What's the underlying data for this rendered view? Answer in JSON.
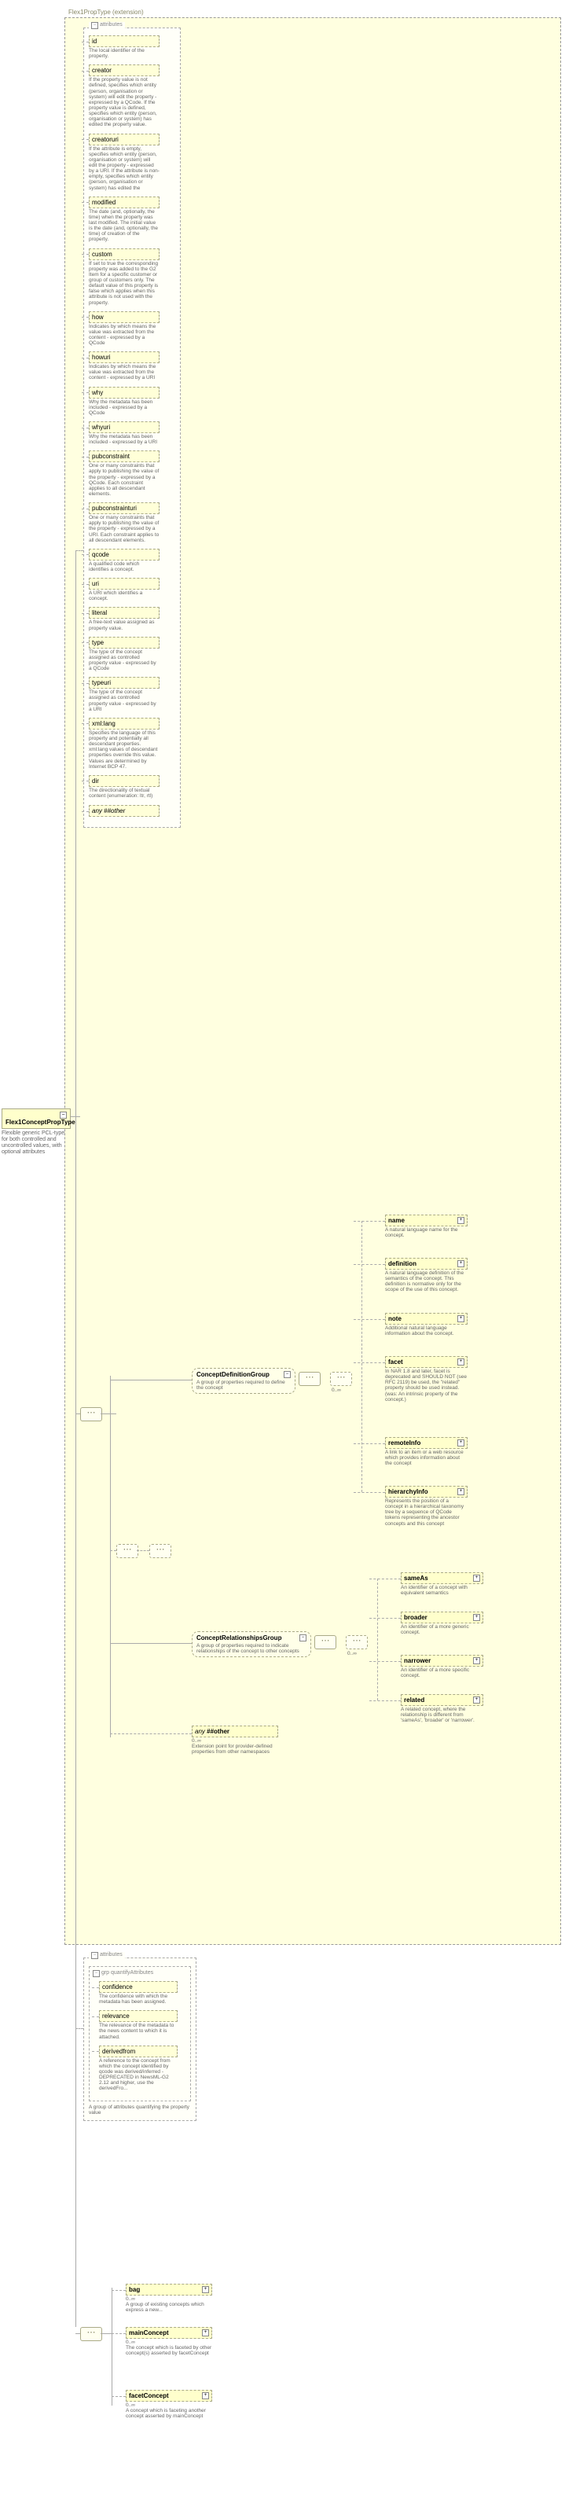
{
  "extension_label": "Flex1PropType (extension)",
  "root": {
    "name": "Flex1ConceptPropType",
    "desc": "Flexible generic PCL-type for both controlled and uncontrolled values, with optional attributes"
  },
  "attributes_label": "attributes",
  "attrs": [
    {
      "name": "id",
      "desc": "The local identifier of the property."
    },
    {
      "name": "creator",
      "desc": "If the property value is not defined, specifies which entity (person, organisation or system) will edit the property - expressed by a QCode. If the property value is defined, specifies which entity (person, organisation or system) has edited the property value."
    },
    {
      "name": "creatoruri",
      "desc": "If the attribute is empty, specifies which entity (person, organisation or system) will edit the property - expressed by a URI. If the attribute is non-empty, specifies which entity (person, organisation or system) has edited the"
    },
    {
      "name": "modified",
      "desc": "The date (and, optionally, the time) when the property was last modified. The initial value is the date (and, optionally, the time) of creation of the property."
    },
    {
      "name": "custom",
      "desc": "If set to true the corresponding property was added to the G2 Item for a specific customer or group of customers only. The default value of this property is false which applies when this attribute is not used with the property."
    },
    {
      "name": "how",
      "desc": "Indicates by which means the value was extracted from the content - expressed by a QCode"
    },
    {
      "name": "howuri",
      "desc": "Indicates by which means the value was extracted from the content - expressed by a URI"
    },
    {
      "name": "why",
      "desc": "Why the metadata has been included - expressed by a QCode"
    },
    {
      "name": "whyuri",
      "desc": "Why the metadata has been included - expressed by a URI"
    },
    {
      "name": "pubconstraint",
      "desc": "One or many constraints that apply to publishing the value of the property - expressed by a QCode. Each constraint applies to all descendant elements."
    },
    {
      "name": "pubconstrainturi",
      "desc": "One or many constraints that apply to publishing the value of the property - expressed by a URI. Each constraint applies to all descendant elements."
    },
    {
      "name": "qcode",
      "desc": "A qualified code which identifies a concept."
    },
    {
      "name": "uri",
      "desc": "A URI which identifies a concept."
    },
    {
      "name": "literal",
      "desc": "A free-text value assigned as property value."
    },
    {
      "name": "type",
      "desc": "The type of the concept assigned as controlled property value - expressed by a QCode"
    },
    {
      "name": "typeuri",
      "desc": "The type of the concept assigned as controlled property value - expressed by a URI"
    },
    {
      "name": "xml:lang",
      "desc": "Specifies the language of this property and potentially all descendant properties. xml:lang values of descendant properties override this value. Values are determined by Internet BCP 47."
    },
    {
      "name": "dir",
      "desc": "The directionality of textual content (enumeration: ltr, rtl)"
    }
  ],
  "attr_any_other": "any ##other",
  "defgroup": {
    "name": "ConceptDefinitionGroup",
    "desc": "A group of properties required to define the concept"
  },
  "defchildren": [
    {
      "name": "name",
      "desc": "A natural language name for the concept."
    },
    {
      "name": "definition",
      "desc": "A natural language definition of the semantics of the concept. This definition is normative only for the scope of the use of this concept."
    },
    {
      "name": "note",
      "desc": "Additional natural language information about the concept."
    },
    {
      "name": "facet",
      "desc": "In NAR 1.8 and later, facet is deprecated and SHOULD NOT (see RFC 2119) be used, the \"related\" property should be used instead.(was: An intrinsic property of the concept.)"
    },
    {
      "name": "remoteInfo",
      "desc": "A link to an item or a web resource which provides information about the concept"
    },
    {
      "name": "hierarchyInfo",
      "desc": "Represents the position of a concept in a hierarchical taxonomy tree by a sequence of QCode tokens representing the ancestor concepts and this concept"
    }
  ],
  "relgroup": {
    "name": "ConceptRelationshipsGroup",
    "desc": "A group of properties required to indicate relationships of the concept to other concepts"
  },
  "relchildren": [
    {
      "name": "sameAs",
      "desc": "An identifier of a concept with equivalent semantics"
    },
    {
      "name": "broader",
      "desc": "An identifier of a more generic concept."
    },
    {
      "name": "narrower",
      "desc": "An identifier of a more specific concept."
    },
    {
      "name": "related",
      "desc": "A related concept, where the relationship is different from 'sameAs', 'broader' or 'narrower'."
    }
  ],
  "any_other2": {
    "pre": "any",
    "ns": "##other",
    "desc": "Extension point for provider-defined properties from other namespaces"
  },
  "card": "0..∞",
  "attributes2_label": "attributes",
  "quant_group": "grp quantifyAttributes",
  "quant_attrs": [
    {
      "name": "confidence",
      "desc": "The confidence with which the metadata has been assigned."
    },
    {
      "name": "relevance",
      "desc": "The relevance of the metadata to the news content to which it is attached."
    },
    {
      "name": "derivedfrom",
      "desc": "A reference to the concept from which the concept identified by qcode was derived/inferred -  DEPRECATED in NewsML-G2 2.12 and higher, use the derivedFro..."
    }
  ],
  "quant_desc": "A group of attributes quantifying the property value",
  "bottom": [
    {
      "name": "bag",
      "desc": "A group of existing concepts which express a new..."
    },
    {
      "name": "mainConcept",
      "desc": "The concept which is faceted by other concept(s) asserted by facetConcept"
    },
    {
      "name": "facetConcept",
      "desc": "A concept which is faceting another concept asserted by mainConcept"
    }
  ]
}
